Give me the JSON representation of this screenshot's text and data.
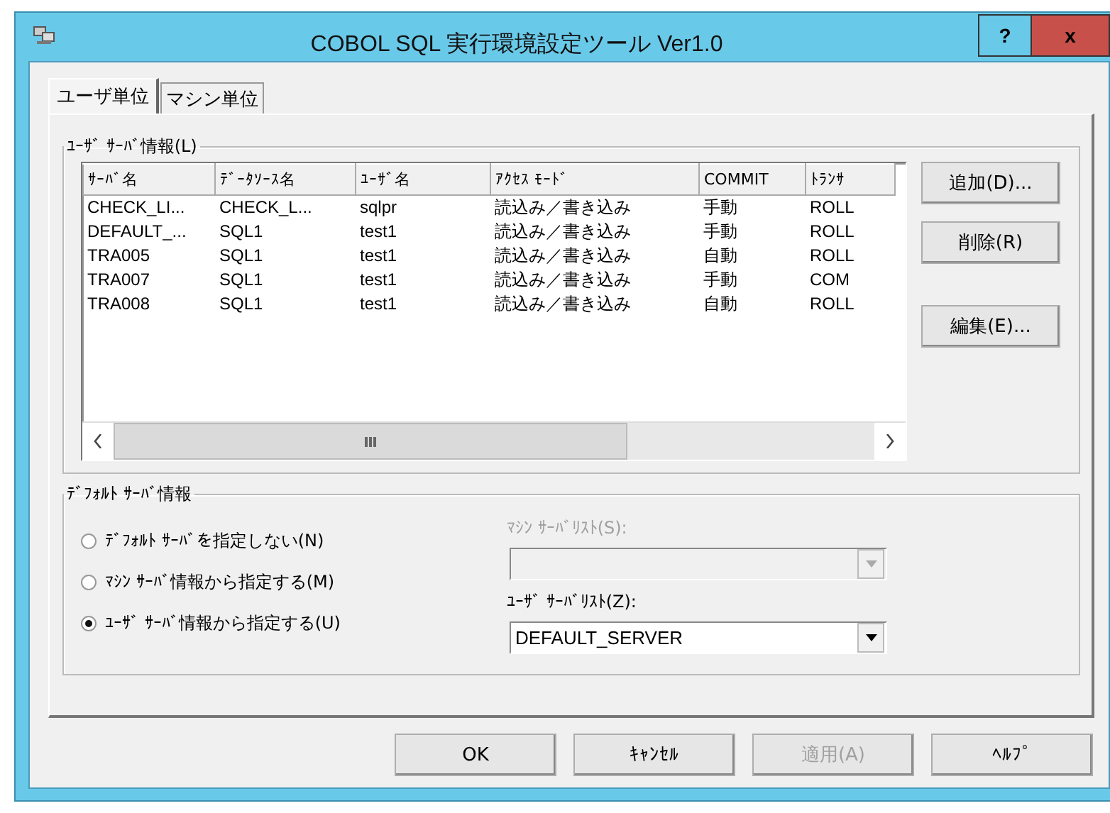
{
  "window": {
    "title": "COBOL SQL 実行環境設定ツール Ver1.0",
    "help_button": "?",
    "close_button": "x"
  },
  "tabs": [
    {
      "label": "ユーザ単位",
      "selected": true
    },
    {
      "label": "マシン単位",
      "selected": false
    }
  ],
  "user_server_group": {
    "label": "ﾕｰｻﾞ ｻｰﾊﾞ情報(L)",
    "table": {
      "columns": [
        "ｻｰﾊﾞ名",
        "ﾃﾞｰﾀｿｰｽ名",
        "ﾕｰｻﾞ名",
        "ｱｸｾｽ ﾓｰﾄﾞ",
        "COMMIT",
        "ﾄﾗﾝｻ"
      ],
      "rows": [
        [
          "CHECK_LI...",
          "CHECK_L...",
          "sqlpr",
          "読込み／書き込み",
          "手動",
          "ROLL"
        ],
        [
          "DEFAULT_...",
          "SQL1",
          "test1",
          "読込み／書き込み",
          "手動",
          "ROLL"
        ],
        [
          "TRA005",
          "SQL1",
          "test1",
          "読込み／書き込み",
          "自動",
          "ROLL"
        ],
        [
          "TRA007",
          "SQL1",
          "test1",
          "読込み／書き込み",
          "手動",
          "COM"
        ],
        [
          "TRA008",
          "SQL1",
          "test1",
          "読込み／書き込み",
          "自動",
          "ROLL"
        ]
      ]
    },
    "buttons": [
      "追加(D)...",
      "削除(R)",
      "編集(E)..."
    ]
  },
  "default_server_group": {
    "label": "ﾃﾞﾌｫﾙﾄ ｻｰﾊﾞ情報",
    "radios": [
      {
        "label": "ﾃﾞﾌｫﾙﾄ ｻｰﾊﾞを指定しない(N)",
        "selected": false
      },
      {
        "label": "ﾏｼﾝ ｻｰﾊﾞ情報から指定する(M)",
        "selected": false
      },
      {
        "label": "ﾕｰｻﾞ ｻｰﾊﾞ情報から指定する(U)",
        "selected": true
      }
    ],
    "combos": [
      {
        "label": "ﾏｼﾝ ｻｰﾊﾞﾘｽﾄ(S):",
        "disabled": true
      },
      {
        "label": "ﾕｰｻﾞ ｻｰﾊﾞﾘｽﾄ(Z):",
        "value": "DEFAULT_SERVER",
        "disabled": false
      }
    ]
  },
  "dialog_buttons": [
    {
      "label": "OK",
      "disabled": false
    },
    {
      "label": "ｷｬﾝｾﾙ",
      "disabled": false
    },
    {
      "label": "適用(A)",
      "disabled": true
    },
    {
      "label": "ﾍﾙﾌﾟ",
      "disabled": false
    }
  ]
}
